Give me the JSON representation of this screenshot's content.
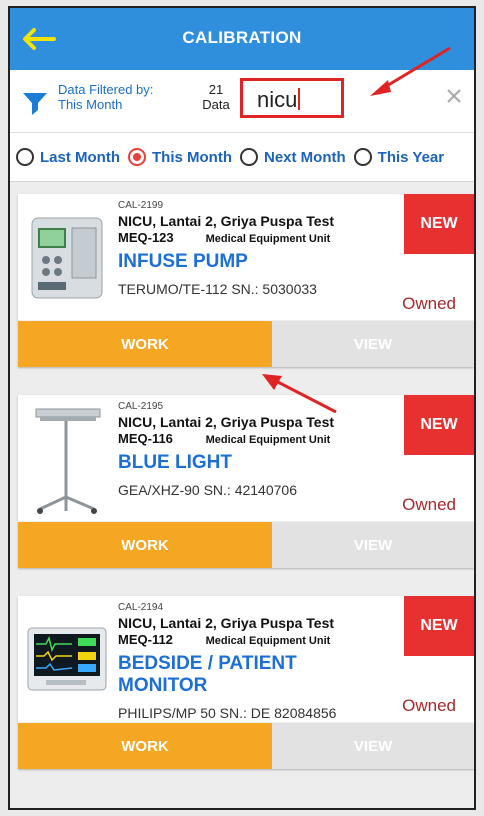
{
  "app": {
    "title": "CALIBRATION"
  },
  "filter": {
    "label_line1": "Data Filtered by:",
    "label_line2": "This Month",
    "count_value": "21",
    "count_label": "Data",
    "search_value": "nicu"
  },
  "period_options": [
    {
      "label": "Last Month",
      "selected": false
    },
    {
      "label": "This Month",
      "selected": true
    },
    {
      "label": "Next Month",
      "selected": false
    },
    {
      "label": "This Year",
      "selected": false
    }
  ],
  "cards": [
    {
      "id": "CAL-2199",
      "location": "NICU, Lantai 2, Griya Puspa Test",
      "meq": "MEQ-123",
      "category": "Medical Equipment Unit",
      "name": "INFUSE PUMP",
      "model_sn": "TERUMO/TE-112  SN.: 5030033",
      "badge": "NEW",
      "ownership": "Owned",
      "work_label": "WORK",
      "view_label": "VIEW"
    },
    {
      "id": "CAL-2195",
      "location": "NICU, Lantai 2, Griya Puspa Test",
      "meq": "MEQ-116",
      "category": "Medical Equipment Unit",
      "name": "BLUE LIGHT",
      "model_sn": "GEA/XHZ-90  SN.: 42140706",
      "badge": "NEW",
      "ownership": "Owned",
      "work_label": "WORK",
      "view_label": "VIEW"
    },
    {
      "id": "CAL-2194",
      "location": "NICU, Lantai 2, Griya Puspa Test",
      "meq": "MEQ-112",
      "category": "Medical Equipment Unit",
      "name": "BEDSIDE / PATIENT MONITOR",
      "model_sn": "PHILIPS/MP 50  SN.: DE 82084856",
      "badge": "NEW",
      "ownership": "Owned",
      "work_label": "WORK",
      "view_label": "VIEW"
    }
  ],
  "colors": {
    "appbar": "#2f8fdc",
    "accent_blue": "#1d6fd6",
    "badge_red": "#e73131",
    "work_orange": "#f5a623",
    "annotation_red": "#e02424"
  },
  "icons": {
    "back": "arrow-left-icon",
    "filter": "funnel-icon",
    "clear": "close-icon"
  }
}
